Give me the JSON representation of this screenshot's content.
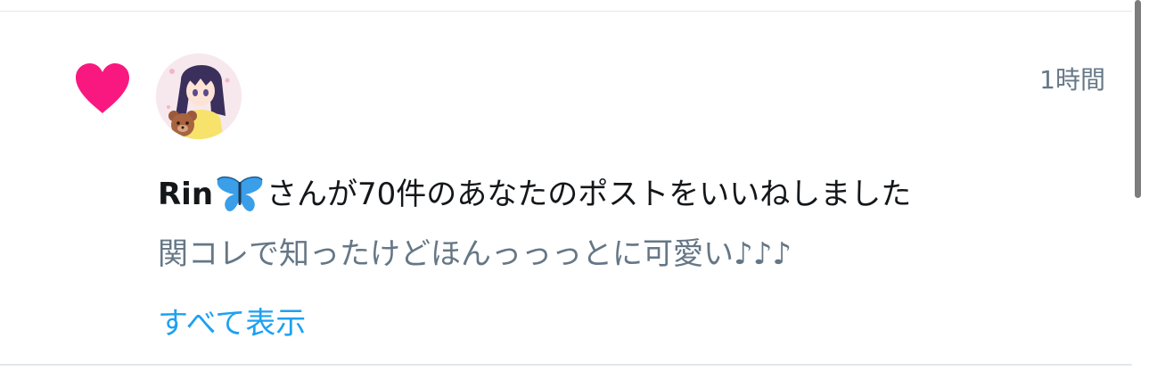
{
  "notification": {
    "time": "1時間",
    "user_name": "Rin",
    "action": "さんが70件のあなたのポストをいいねしました",
    "tweet_text": "関コレで知ったけどほんっっっとに可愛い♪♪♪",
    "show_all": "すべて表示"
  },
  "icons": {
    "like": "heart-icon",
    "user_badge": "butterfly-icon",
    "avatar": "anime-girl-with-teddy-bear"
  },
  "colors": {
    "heart": "#f91880",
    "link": "#1da1f2",
    "secondary_text": "#657786",
    "primary_text": "#14171a",
    "butterfly": "#3a9ee8"
  }
}
